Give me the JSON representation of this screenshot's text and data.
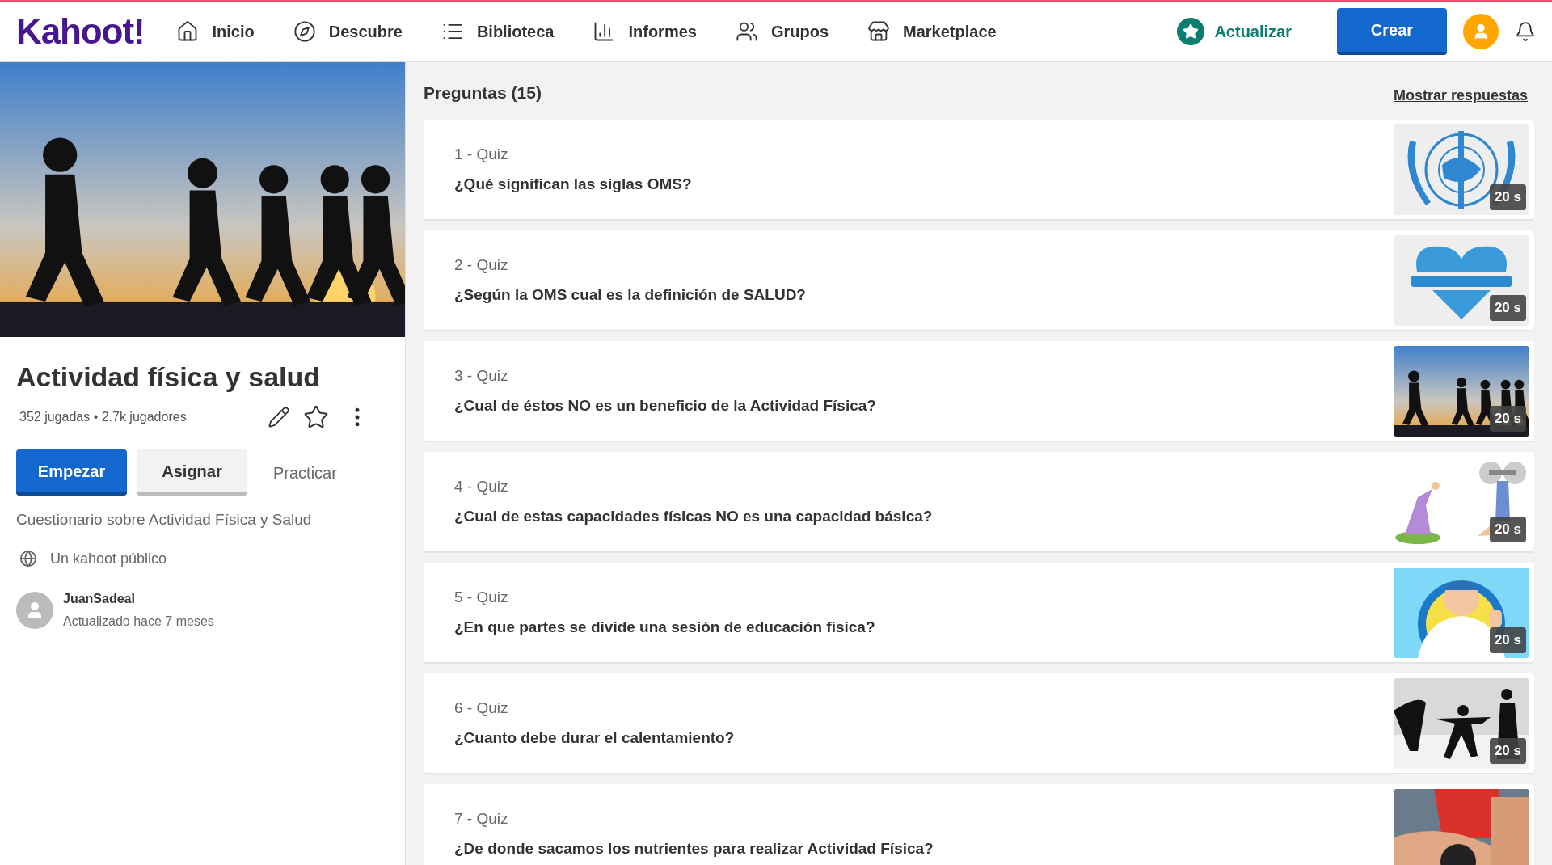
{
  "nav": {
    "logo": "Kahoot!",
    "items": [
      {
        "label": "Inicio"
      },
      {
        "label": "Descubre"
      },
      {
        "label": "Biblioteca"
      },
      {
        "label": "Informes"
      },
      {
        "label": "Grupos"
      },
      {
        "label": "Marketplace"
      }
    ],
    "upgrade": "Actualizar",
    "create": "Crear"
  },
  "kahoot": {
    "title": "Actividad física y salud",
    "stats": "352 jugadas • 2.7k jugadores",
    "buttons": {
      "start": "Empezar",
      "assign": "Asignar",
      "practice": "Practicar"
    },
    "description": "Cuestionario sobre Actividad Física y Salud",
    "visibility": "Un kahoot público",
    "author": "JuanSadeal",
    "updated": "Actualizado hace 7 meses"
  },
  "questions": {
    "title": "Preguntas (15)",
    "show_answers": "Mostrar respuestas",
    "items": [
      {
        "type": "1 - Quiz",
        "text": "¿Qué significan las siglas OMS?",
        "time": "20 s"
      },
      {
        "type": "2 - Quiz",
        "text": "¿Según la OMS cual es la definición de SALUD?",
        "time": "20 s"
      },
      {
        "type": "3 - Quiz",
        "text": "¿Cual de éstos NO es un beneficio de la Actividad Física?",
        "time": "20 s"
      },
      {
        "type": "4 - Quiz",
        "text": "¿Cual de estas capacidades físicas NO es una capacidad básica?",
        "time": "20 s"
      },
      {
        "type": "5 - Quiz",
        "text": "¿En que partes se divide una sesión de educación física?",
        "time": "20 s"
      },
      {
        "type": "6 - Quiz",
        "text": "¿Cuanto debe durar el calentamiento?",
        "time": "20 s"
      },
      {
        "type": "7 - Quiz",
        "text": "¿De donde sacamos los nutrientes para realizar Actividad Física?"
      }
    ]
  }
}
